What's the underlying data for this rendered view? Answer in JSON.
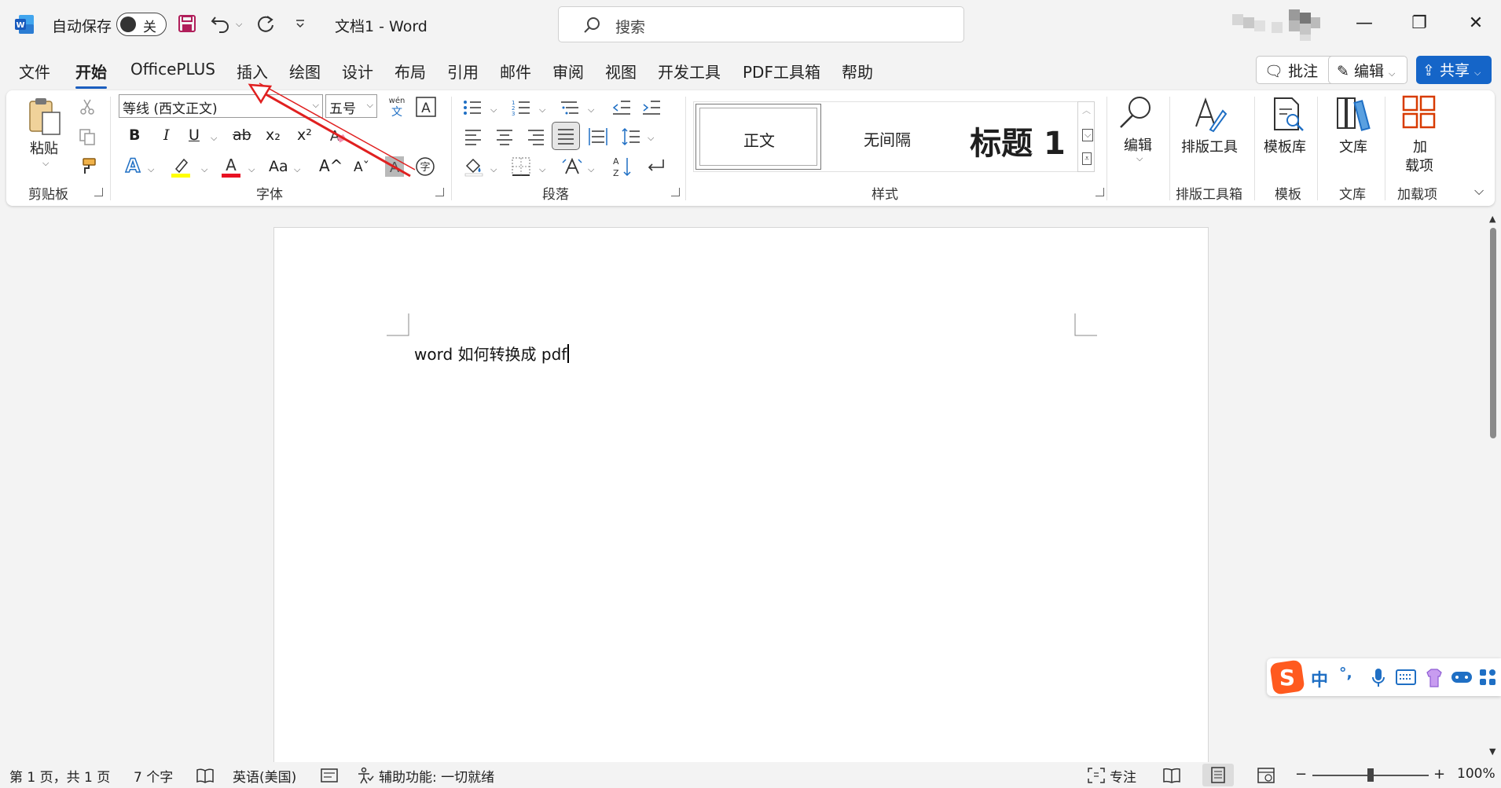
{
  "titlebar": {
    "autosave_label": "自动保存",
    "autosave_state": "关",
    "doc_title": "文档1  -  Word",
    "search_placeholder": "搜索",
    "minimize": "—",
    "restore": "❐",
    "close": "✕"
  },
  "tabs": [
    "文件",
    "开始",
    "OfficePLUS",
    "插入",
    "绘图",
    "设计",
    "布局",
    "引用",
    "邮件",
    "审阅",
    "视图",
    "开发工具",
    "PDF工具箱",
    "帮助"
  ],
  "active_tab": "开始",
  "right_buttons": {
    "comments": "批注",
    "editing": "编辑",
    "share": "共享"
  },
  "ribbon": {
    "clipboard": {
      "paste": "粘贴",
      "label": "剪贴板"
    },
    "font": {
      "font_name": "等线 (西文正文)",
      "font_size": "五号",
      "label": "字体",
      "bold": "B",
      "italic": "I",
      "underline": "U",
      "strike": "ab",
      "sub": "x₂",
      "sup": "x²",
      "grow": "A^",
      "shrink": "Aˇ",
      "case": "Aa"
    },
    "paragraph": {
      "label": "段落"
    },
    "styles": {
      "normal": "正文",
      "no_spacing": "无间隔",
      "heading1": "标题 1",
      "label": "样式"
    },
    "editing": {
      "label": "编辑"
    },
    "layout_tools": {
      "btn": "排版工具",
      "label": "排版工具箱"
    },
    "templates": {
      "btn": "模板库",
      "label": "模板"
    },
    "library": {
      "btn": "文库",
      "label": "文库"
    },
    "addins": {
      "btn_line1": "加",
      "btn_line2": "载项",
      "label": "加载项"
    }
  },
  "document": {
    "text": "word 如何转换成 pdf"
  },
  "statusbar": {
    "page": "第 1 页，共 1 页",
    "words": "7 个字",
    "language": "英语(美国)",
    "accessibility": "辅助功能: 一切就绪",
    "focus": "专注",
    "zoom": "100%"
  },
  "ime": {
    "mode": "中",
    "punct": "°,"
  },
  "colors": {
    "accent": "#1565c8",
    "word_blue": "#185abd",
    "annotation_arrow": "#e02020"
  }
}
